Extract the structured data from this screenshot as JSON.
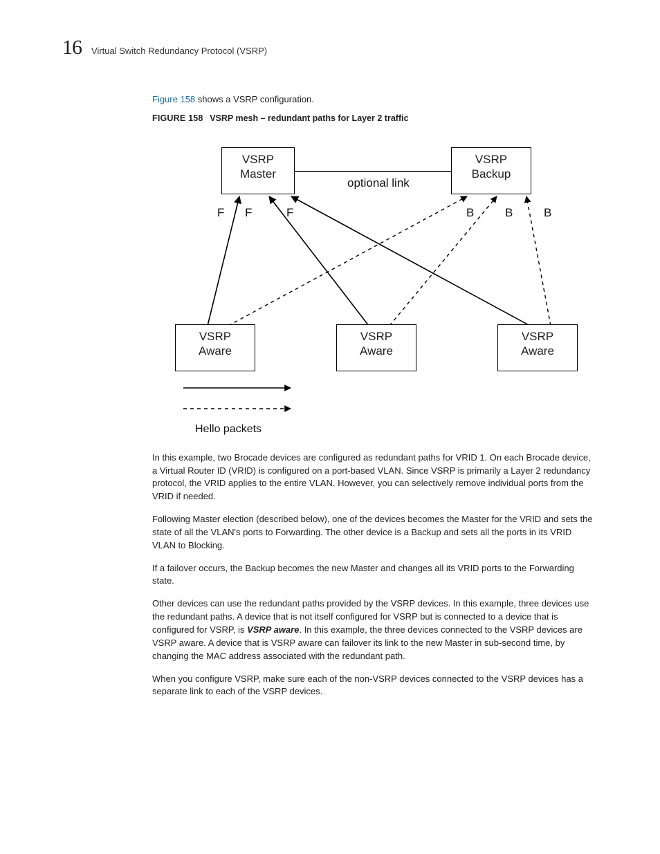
{
  "header": {
    "chapter_number": "16",
    "title": "Virtual Switch Redundancy Protocol (VSRP)"
  },
  "intro": {
    "link_text": "Figure 158",
    "rest": " shows a VSRP configuration."
  },
  "figure": {
    "label": "FIGURE 158",
    "caption": "VSRP mesh – redundant paths for Layer 2 traffic"
  },
  "diagram": {
    "nodes": {
      "master": {
        "l1": "VSRP",
        "l2": "Master"
      },
      "backup": {
        "l1": "VSRP",
        "l2": "Backup"
      },
      "aware1": {
        "l1": "VSRP",
        "l2": "Aware"
      },
      "aware2": {
        "l1": "VSRP",
        "l2": "Aware"
      },
      "aware3": {
        "l1": "VSRP",
        "l2": "Aware"
      }
    },
    "labels": {
      "optional_link": "optional link",
      "F1": "F",
      "F2": "F",
      "F3": "F",
      "B1": "B",
      "B2": "B",
      "B3": "B",
      "legend": "Hello packets"
    }
  },
  "paragraphs": {
    "p1": "In this example, two Brocade devices are configured as redundant paths for VRID 1. On each Brocade device, a Virtual Router ID (VRID) is configured on a port-based VLAN. Since VSRP is primarily a Layer 2 redundancy protocol, the VRID applies to the entire VLAN. However, you can selectively remove individual ports from the VRID if needed.",
    "p2": "Following Master election (described below), one of the devices becomes the Master for the VRID and sets the state of all the VLAN's ports to Forwarding. The other device is a Backup and sets all the ports in its VRID VLAN to Blocking.",
    "p3": "If a failover occurs, the Backup becomes the new Master and changes all its VRID ports to the Forwarding state.",
    "p4a": "Other devices can use the redundant paths provided by the VSRP devices. In this example, three devices use the redundant paths. A device that is not itself configured for VSRP but is connected to a device that is configured for VSRP, is ",
    "p4b": "VSRP aware",
    "p4c": ". In this example, the three devices connected to the VSRP devices are VSRP aware. A device that is VSRP aware can failover its link to the new Master in sub-second time, by changing the MAC address associated with the redundant path.",
    "p5": "When you configure VSRP, make sure each of the non-VSRP devices connected to the VSRP devices has a separate link to each of the VSRP devices."
  }
}
